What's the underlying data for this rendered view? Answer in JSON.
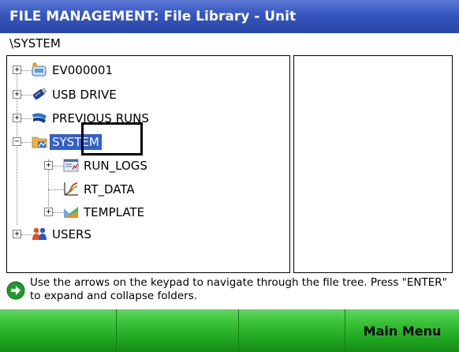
{
  "window": {
    "title": "FILE MANAGEMENT: File Library - Unit"
  },
  "path": "\\SYSTEM",
  "tree": {
    "nodes": [
      {
        "label": "EV000001",
        "icon": "device-icon",
        "expander": "+"
      },
      {
        "label": "USB DRIVE",
        "icon": "usb-drive-icon",
        "expander": "+"
      },
      {
        "label": "PREVIOUS RUNS",
        "icon": "previous-runs-icon",
        "expander": "+"
      },
      {
        "label": "SYSTEM",
        "icon": "system-folder-icon",
        "expander": "−",
        "selected": true
      },
      {
        "label": "RUN_LOGS",
        "icon": "run-logs-icon",
        "expander": "+"
      },
      {
        "label": "RT_DATA",
        "icon": "rt-data-icon",
        "expander": ""
      },
      {
        "label": "TEMPLATE",
        "icon": "template-icon",
        "expander": "+"
      },
      {
        "label": "USERS",
        "icon": "users-icon",
        "expander": "+"
      }
    ]
  },
  "hint": {
    "icon": "arrow-right-circle-icon",
    "text": "Use the arrows on the keypad to navigate through the file tree.  Press \"ENTER\" to expand and collapse folders."
  },
  "softkeys": [
    {
      "label": ""
    },
    {
      "label": ""
    },
    {
      "label": ""
    },
    {
      "label": "Main Menu"
    }
  ],
  "colors": {
    "titlebar": "#3656be",
    "selection": "#3360c9",
    "softkey": "#35c035"
  }
}
